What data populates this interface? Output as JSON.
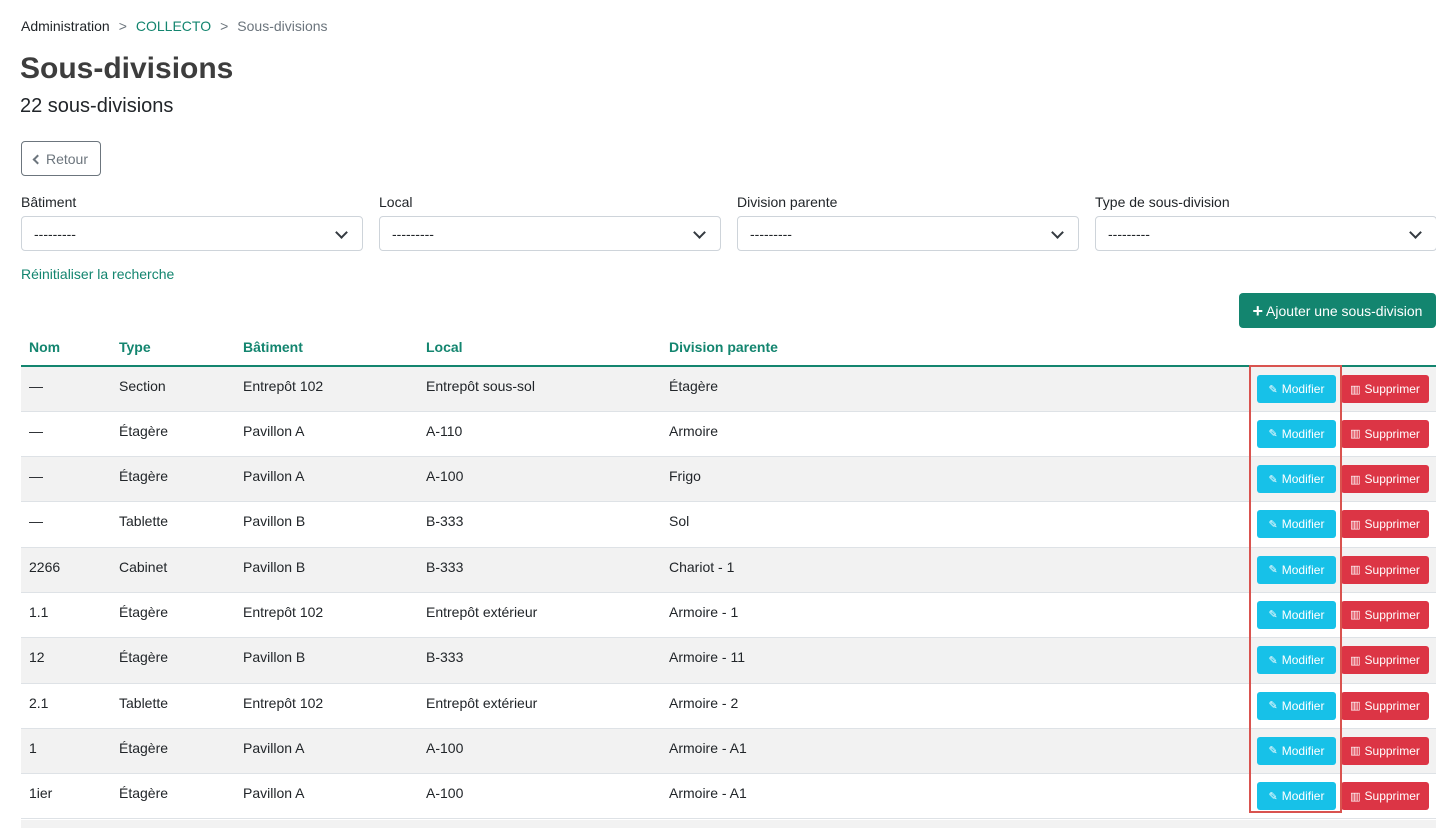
{
  "breadcrumb": {
    "admin": "Administration",
    "separator": ">",
    "collecto": "COLLECTO",
    "current": "Sous-divisions"
  },
  "page": {
    "title": "Sous-divisions",
    "subtitle": "22 sous-divisions"
  },
  "back_button": {
    "label": "Retour"
  },
  "filters": [
    {
      "label": "Bâtiment",
      "value": "---------"
    },
    {
      "label": "Local",
      "value": "---------"
    },
    {
      "label": "Division parente",
      "value": "---------"
    },
    {
      "label": "Type de sous-division",
      "value": "---------"
    }
  ],
  "reset_link": "Réinitialiser la recherche",
  "add_button": {
    "icon": "plus-icon",
    "label": "Ajouter une sous-division"
  },
  "table": {
    "headers": [
      "Nom",
      "Type",
      "Bâtiment",
      "Local",
      "Division parente"
    ],
    "rows": [
      [
        "—",
        "Section",
        "Entrepôt 102",
        "Entrepôt sous-sol",
        "Étagère"
      ],
      [
        "—",
        "Étagère",
        "Pavillon A",
        "A-110",
        "Armoire"
      ],
      [
        "—",
        "Étagère",
        "Pavillon A",
        "A-100",
        "Frigo"
      ],
      [
        "—",
        "Tablette",
        "Pavillon B",
        "B-333",
        "Sol"
      ],
      [
        "2266",
        "Cabinet",
        "Pavillon B",
        "B-333",
        "Chariot - 1"
      ],
      [
        "1.1",
        "Étagère",
        "Entrepôt 102",
        "Entrepôt extérieur",
        "Armoire - 1"
      ],
      [
        "12",
        "Étagère",
        "Pavillon B",
        "B-333",
        "Armoire - 11"
      ],
      [
        "2.1",
        "Tablette",
        "Entrepôt 102",
        "Entrepôt extérieur",
        "Armoire - 2"
      ],
      [
        "1",
        "Étagère",
        "Pavillon A",
        "A-100",
        "Armoire - A1"
      ],
      [
        "1ier",
        "Étagère",
        "Pavillon A",
        "A-100",
        "Armoire - A1"
      ]
    ],
    "edit_label": "Modifier",
    "delete_label": "Supprimer"
  },
  "colors": {
    "accent": "#13856f",
    "edit": "#17c1e8",
    "delete": "#dc3545",
    "highlight": "#d9534f"
  }
}
